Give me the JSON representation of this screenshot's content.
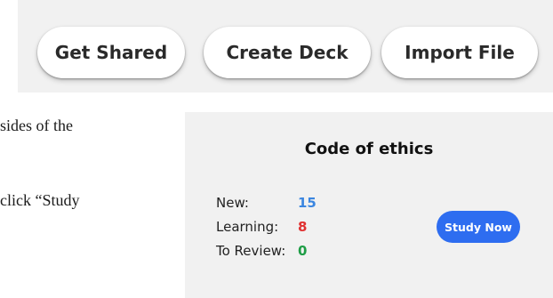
{
  "toolbar": {
    "buttons": [
      {
        "label": "Get Shared"
      },
      {
        "label": "Create Deck"
      },
      {
        "label": "Import File"
      }
    ]
  },
  "document_fragments": [
    "sides of the",
    "click “Study"
  ],
  "deck": {
    "title": "Code of ethics",
    "stats": {
      "new": {
        "label": "New:",
        "value": "15",
        "color": "#3b86e0"
      },
      "learning": {
        "label": "Learning:",
        "value": "8",
        "color": "#e03131"
      },
      "to_review": {
        "label": "To Review:",
        "value": "0",
        "color": "#1f9d46"
      }
    },
    "study_button": {
      "label": "Study Now",
      "color": "#2e6df0"
    }
  }
}
